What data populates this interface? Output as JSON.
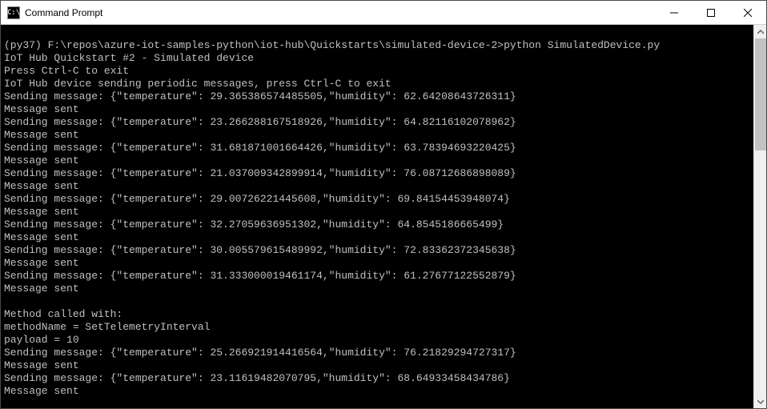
{
  "window": {
    "title": "Command Prompt",
    "icon_text": "C:\\"
  },
  "terminal": {
    "prompt_prefix": "(py37) ",
    "prompt_path": "F:\\repos\\azure-iot-samples-python\\iot-hub\\Quickstarts\\simulated-device-2>",
    "prompt_command": "python SimulatedDevice.py",
    "header_line": "IoT Hub Quickstart #2 - Simulated device",
    "exit_line": "Press Ctrl-C to exit",
    "device_line": "IoT Hub device sending periodic messages, press Ctrl-C to exit",
    "sending_prefix": "Sending message: ",
    "sent_line": "Message sent",
    "method_called": "Method called with:",
    "method_name_line": "methodName = SetTelemetryInterval",
    "payload_line": "payload = 10",
    "messages_block1": [
      {
        "temperature": "29.365386574485505",
        "humidity": "62.64208643726311"
      },
      {
        "temperature": "23.266288167518926",
        "humidity": "64.82116102078962"
      },
      {
        "temperature": "31.681871001664426",
        "humidity": "63.78394693220425"
      },
      {
        "temperature": "21.037009342899914",
        "humidity": "76.08712686898089"
      },
      {
        "temperature": "29.00726221445608",
        "humidity": "69.84154453948074"
      },
      {
        "temperature": "32.27059636951302",
        "humidity": "64.8545186665499"
      },
      {
        "temperature": "30.005579615489992",
        "humidity": "72.83362372345638"
      },
      {
        "temperature": "31.333000019461174",
        "humidity": "61.27677122552879"
      }
    ],
    "messages_block2": [
      {
        "temperature": "25.266921914416564",
        "humidity": "76.21829294727317"
      },
      {
        "temperature": "23.11619482070795",
        "humidity": "68.64933458434786"
      }
    ]
  }
}
